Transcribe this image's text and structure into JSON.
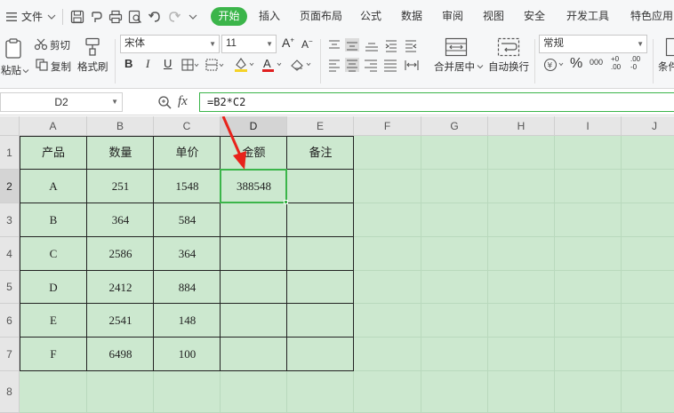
{
  "menubar": {
    "file_label": "文件",
    "tabs": [
      "开始",
      "插入",
      "页面布局",
      "公式",
      "数据",
      "审阅",
      "视图",
      "安全",
      "开发工具",
      "特色应用"
    ],
    "active_tab": "开始"
  },
  "ribbon": {
    "paste_label": "粘贴",
    "cut_label": "剪切",
    "copy_label": "复制",
    "format_painter_label": "格式刷",
    "font_name": "宋体",
    "font_size": "11",
    "merge_center_label": "合并居中",
    "wrap_text_label": "自动换行",
    "number_format": "常规",
    "conditional_label": "条件",
    "bold": "B",
    "italic": "I",
    "underline": "U",
    "increase_font": "A",
    "decrease_font": "A",
    "font_color_glyph": "A",
    "percent_glyph": "%",
    "thousands_glyph": "000",
    "dec_inc_glyph": "+0 .00",
    "dec_dec_glyph": ".00 -0"
  },
  "formula_bar": {
    "cell_ref": "D2",
    "fx_label": "fx",
    "formula": "=B2*C2"
  },
  "grid": {
    "columns": [
      "A",
      "B",
      "C",
      "D",
      "E",
      "F",
      "G",
      "H",
      "I",
      "J"
    ],
    "rows": [
      "1",
      "2",
      "3",
      "4",
      "5",
      "6",
      "7",
      "8"
    ],
    "selected_column": "D",
    "selected_row": "2",
    "header": [
      "产品",
      "数量",
      "单价",
      "金额",
      "备注"
    ],
    "data": [
      [
        "A",
        "251",
        "1548",
        "388548",
        ""
      ],
      [
        "B",
        "364",
        "584",
        "",
        ""
      ],
      [
        "C",
        "2586",
        "364",
        "",
        ""
      ],
      [
        "D",
        "2412",
        "884",
        "",
        ""
      ],
      [
        "E",
        "2541",
        "148",
        "",
        ""
      ],
      [
        "F",
        "6498",
        "100",
        "",
        ""
      ]
    ]
  },
  "colors": {
    "accent": "#3bb54a",
    "grid_background": "#cce8cf",
    "annotation_arrow": "#e8231b"
  }
}
